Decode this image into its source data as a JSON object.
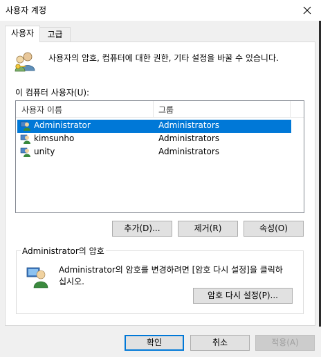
{
  "window": {
    "title": "사용자 계정",
    "close_glyph": "✕"
  },
  "tabs": [
    {
      "label": "사용자",
      "active": true
    },
    {
      "label": "고급",
      "active": false
    }
  ],
  "users_tab": {
    "description": "사용자의 암호, 컴퓨터에 대한 권한, 기타 설정을 바꿀 수 있습니다.",
    "list_label": "이 컴퓨터 사용자(U):",
    "columns": [
      "사용자 이름",
      "그룹"
    ],
    "users": [
      {
        "name": "Administrator",
        "group": "Administrators",
        "selected": true
      },
      {
        "name": "kimsunho",
        "group": "Administrators",
        "selected": false
      },
      {
        "name": "unity",
        "group": "Administrators",
        "selected": false
      }
    ],
    "buttons": {
      "add": "추가(D)...",
      "remove": "제거(R)",
      "properties": "속성(O)"
    },
    "password_group": {
      "title": "Administrator의 암호",
      "text_line1": "Administrator의 암호를 변경하려면 [암호 다시 설정]을 클릭하",
      "text_line2": "십시오.",
      "reset_button": "암호 다시 설정(P)..."
    }
  },
  "footer": {
    "ok": "확인",
    "cancel": "취소",
    "apply": "적용(A)"
  },
  "colors": {
    "selection": "#0078d7",
    "default_button_border": "#0078d7",
    "window_bg": "#f0f0f0"
  },
  "icons": [
    "close-icon",
    "users-keys-icon",
    "user-icon",
    "password-user-icon"
  ]
}
